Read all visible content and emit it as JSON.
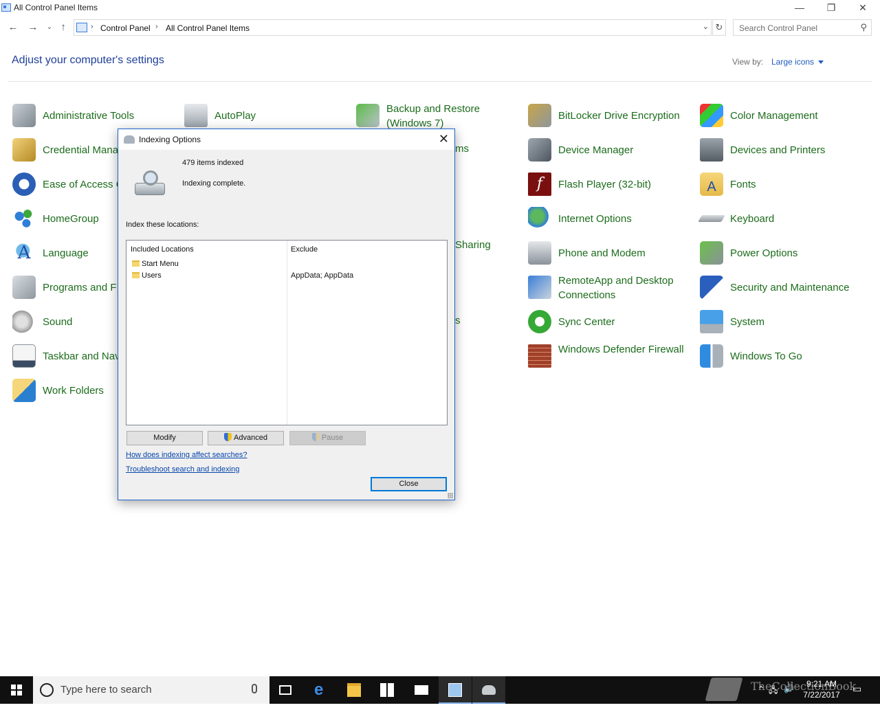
{
  "window": {
    "title": "All Control Panel Items",
    "controls": {
      "minimize": "—",
      "restore": "❐",
      "close": "✕"
    }
  },
  "address": {
    "crumbs": [
      "Control Panel",
      "All Control Panel Items"
    ],
    "search_placeholder": "Search Control Panel"
  },
  "header": {
    "title": "Adjust your computer's settings",
    "view_by_label": "View by:",
    "view_by_value": "Large icons"
  },
  "items": {
    "administrative_tools": "Administrative Tools",
    "autoplay": "AutoPlay",
    "backup_restore": "Backup and Restore (Windows 7)",
    "bitlocker": "BitLocker Drive Encryption",
    "color_management": "Color Management",
    "credential_manager": "Credential Mana",
    "programs_partial": "ms",
    "device_manager": "Device Manager",
    "devices_printers": "Devices and Printers",
    "ease_of_access": "Ease of Access C",
    "flash_player": "Flash Player (32-bit)",
    "fonts": "Fonts",
    "homegroup": "HomeGroup",
    "internet_options": "Internet Options",
    "keyboard": "Keyboard",
    "language": "Language",
    "sharing_partial": "Sharing",
    "phone_modem": "Phone and Modem",
    "power_options": "Power Options",
    "programs_features": "Programs and F",
    "remoteapp": "RemoteApp and Desktop Connections",
    "security_maintenance": "Security and Maintenance",
    "sound": "Sound",
    "s_partial": "s",
    "sync_center": "Sync Center",
    "system": "System",
    "taskbar_nav": "Taskbar and Nav",
    "defender_firewall": "Windows Defender Firewall",
    "windows_to_go": "Windows To Go",
    "work_folders": "Work Folders"
  },
  "dialog": {
    "title": "Indexing Options",
    "items_indexed": "479 items indexed",
    "status": "Indexing complete.",
    "index_locations_label": "Index these locations:",
    "col_included": "Included Locations",
    "col_exclude": "Exclude",
    "locations": [
      {
        "name": "Start Menu",
        "exclude": ""
      },
      {
        "name": "Users",
        "exclude": "AppData; AppData"
      }
    ],
    "buttons": {
      "modify": "Modify",
      "advanced": "Advanced",
      "pause": "Pause",
      "close": "Close"
    },
    "links": {
      "how": "How does indexing affect searches?",
      "troubleshoot": "Troubleshoot search and indexing"
    }
  },
  "taskbar": {
    "search_placeholder": "Type here to search",
    "time": "9:21 AM",
    "date": "7/22/2017",
    "watermark": "TheCollectionBook"
  },
  "colors": {
    "link_green": "#1c6c1c",
    "heading_blue": "#1e3f99",
    "accent": "#0078d7"
  }
}
